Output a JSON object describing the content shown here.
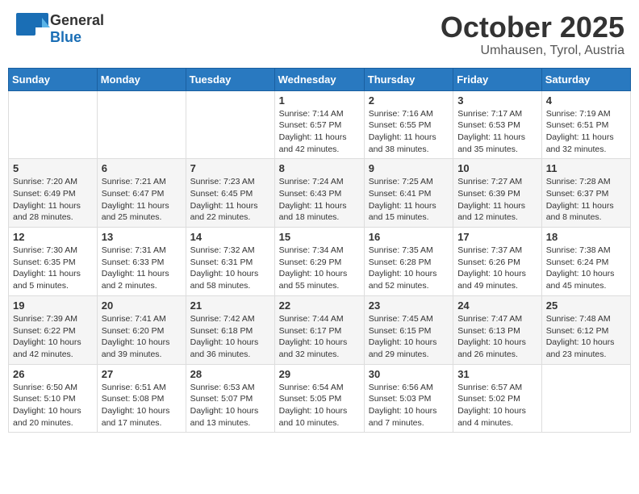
{
  "header": {
    "logo_general": "General",
    "logo_blue": "Blue",
    "month_title": "October 2025",
    "location": "Umhausen, Tyrol, Austria"
  },
  "weekdays": [
    "Sunday",
    "Monday",
    "Tuesday",
    "Wednesday",
    "Thursday",
    "Friday",
    "Saturday"
  ],
  "weeks": [
    [
      {
        "day": "",
        "info": ""
      },
      {
        "day": "",
        "info": ""
      },
      {
        "day": "",
        "info": ""
      },
      {
        "day": "1",
        "info": "Sunrise: 7:14 AM\nSunset: 6:57 PM\nDaylight: 11 hours and 42 minutes."
      },
      {
        "day": "2",
        "info": "Sunrise: 7:16 AM\nSunset: 6:55 PM\nDaylight: 11 hours and 38 minutes."
      },
      {
        "day": "3",
        "info": "Sunrise: 7:17 AM\nSunset: 6:53 PM\nDaylight: 11 hours and 35 minutes."
      },
      {
        "day": "4",
        "info": "Sunrise: 7:19 AM\nSunset: 6:51 PM\nDaylight: 11 hours and 32 minutes."
      }
    ],
    [
      {
        "day": "5",
        "info": "Sunrise: 7:20 AM\nSunset: 6:49 PM\nDaylight: 11 hours and 28 minutes."
      },
      {
        "day": "6",
        "info": "Sunrise: 7:21 AM\nSunset: 6:47 PM\nDaylight: 11 hours and 25 minutes."
      },
      {
        "day": "7",
        "info": "Sunrise: 7:23 AM\nSunset: 6:45 PM\nDaylight: 11 hours and 22 minutes."
      },
      {
        "day": "8",
        "info": "Sunrise: 7:24 AM\nSunset: 6:43 PM\nDaylight: 11 hours and 18 minutes."
      },
      {
        "day": "9",
        "info": "Sunrise: 7:25 AM\nSunset: 6:41 PM\nDaylight: 11 hours and 15 minutes."
      },
      {
        "day": "10",
        "info": "Sunrise: 7:27 AM\nSunset: 6:39 PM\nDaylight: 11 hours and 12 minutes."
      },
      {
        "day": "11",
        "info": "Sunrise: 7:28 AM\nSunset: 6:37 PM\nDaylight: 11 hours and 8 minutes."
      }
    ],
    [
      {
        "day": "12",
        "info": "Sunrise: 7:30 AM\nSunset: 6:35 PM\nDaylight: 11 hours and 5 minutes."
      },
      {
        "day": "13",
        "info": "Sunrise: 7:31 AM\nSunset: 6:33 PM\nDaylight: 11 hours and 2 minutes."
      },
      {
        "day": "14",
        "info": "Sunrise: 7:32 AM\nSunset: 6:31 PM\nDaylight: 10 hours and 58 minutes."
      },
      {
        "day": "15",
        "info": "Sunrise: 7:34 AM\nSunset: 6:29 PM\nDaylight: 10 hours and 55 minutes."
      },
      {
        "day": "16",
        "info": "Sunrise: 7:35 AM\nSunset: 6:28 PM\nDaylight: 10 hours and 52 minutes."
      },
      {
        "day": "17",
        "info": "Sunrise: 7:37 AM\nSunset: 6:26 PM\nDaylight: 10 hours and 49 minutes."
      },
      {
        "day": "18",
        "info": "Sunrise: 7:38 AM\nSunset: 6:24 PM\nDaylight: 10 hours and 45 minutes."
      }
    ],
    [
      {
        "day": "19",
        "info": "Sunrise: 7:39 AM\nSunset: 6:22 PM\nDaylight: 10 hours and 42 minutes."
      },
      {
        "day": "20",
        "info": "Sunrise: 7:41 AM\nSunset: 6:20 PM\nDaylight: 10 hours and 39 minutes."
      },
      {
        "day": "21",
        "info": "Sunrise: 7:42 AM\nSunset: 6:18 PM\nDaylight: 10 hours and 36 minutes."
      },
      {
        "day": "22",
        "info": "Sunrise: 7:44 AM\nSunset: 6:17 PM\nDaylight: 10 hours and 32 minutes."
      },
      {
        "day": "23",
        "info": "Sunrise: 7:45 AM\nSunset: 6:15 PM\nDaylight: 10 hours and 29 minutes."
      },
      {
        "day": "24",
        "info": "Sunrise: 7:47 AM\nSunset: 6:13 PM\nDaylight: 10 hours and 26 minutes."
      },
      {
        "day": "25",
        "info": "Sunrise: 7:48 AM\nSunset: 6:12 PM\nDaylight: 10 hours and 23 minutes."
      }
    ],
    [
      {
        "day": "26",
        "info": "Sunrise: 6:50 AM\nSunset: 5:10 PM\nDaylight: 10 hours and 20 minutes."
      },
      {
        "day": "27",
        "info": "Sunrise: 6:51 AM\nSunset: 5:08 PM\nDaylight: 10 hours and 17 minutes."
      },
      {
        "day": "28",
        "info": "Sunrise: 6:53 AM\nSunset: 5:07 PM\nDaylight: 10 hours and 13 minutes."
      },
      {
        "day": "29",
        "info": "Sunrise: 6:54 AM\nSunset: 5:05 PM\nDaylight: 10 hours and 10 minutes."
      },
      {
        "day": "30",
        "info": "Sunrise: 6:56 AM\nSunset: 5:03 PM\nDaylight: 10 hours and 7 minutes."
      },
      {
        "day": "31",
        "info": "Sunrise: 6:57 AM\nSunset: 5:02 PM\nDaylight: 10 hours and 4 minutes."
      },
      {
        "day": "",
        "info": ""
      }
    ]
  ]
}
